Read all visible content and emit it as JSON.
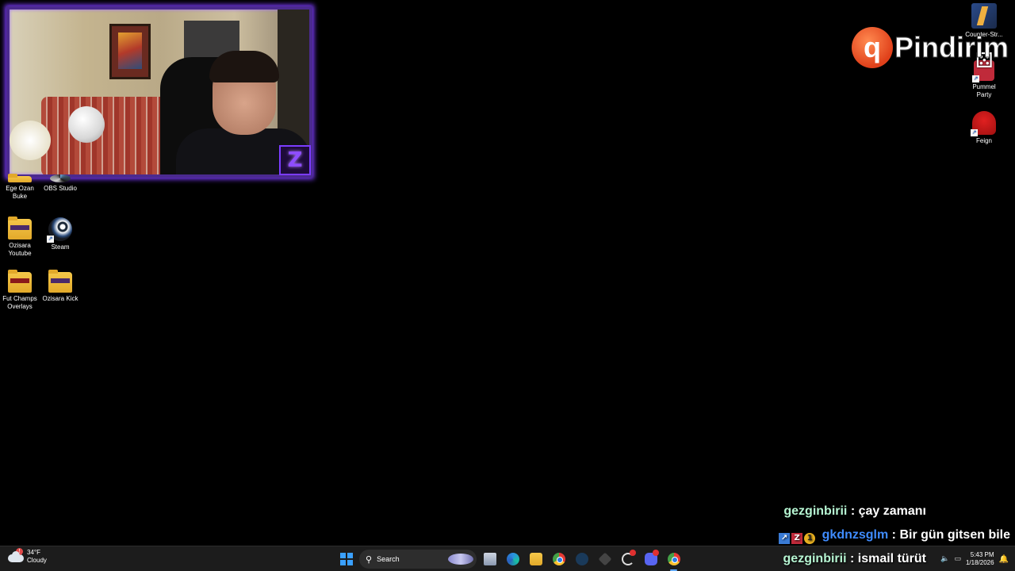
{
  "desktop": {
    "left_icons": [
      {
        "label": "Ege Ozan Buke",
        "icon": "folder-icon"
      },
      {
        "label": "OBS Studio",
        "icon": "obs-icon"
      },
      {
        "label": "Ozisara Youtube",
        "icon": "folder-icon"
      },
      {
        "label": "Steam",
        "icon": "steam-icon"
      },
      {
        "label": "Fut Champs Overlays",
        "icon": "folder-icon"
      },
      {
        "label": "Ozisara Kick",
        "icon": "folder-icon"
      }
    ],
    "right_icons": [
      {
        "label": "Counter-Str...",
        "icon": "counter-strike-icon"
      },
      {
        "label": "Pummel Party",
        "icon": "pummel-party-icon"
      },
      {
        "label": "Feign",
        "icon": "feign-icon"
      }
    ]
  },
  "overlay": {
    "logo_text": "Pindirim",
    "logo_mark": "q",
    "badge_glyph": "Z",
    "chat": [
      {
        "user": "gezginbirii",
        "separator": ":",
        "message": "çay zamanı",
        "user_color": "#b6f5d2"
      },
      {
        "user": "gkdnzsglm",
        "separator": ":",
        "message": "Bir gün gitsen bile",
        "user_color": "#3f8cff",
        "badges": [
          "↗",
          "Z",
          "1"
        ]
      },
      {
        "user": "gezginbirii",
        "separator": ":",
        "message": "ismail türüt",
        "user_color": "#b6f5d2"
      }
    ]
  },
  "taskbar": {
    "weather": {
      "temp": "34°F",
      "condition": "Cloudy",
      "alert_count": "!"
    },
    "search_placeholder": "Search",
    "tray": {
      "time": "5:43 PM",
      "date": "1/18/2026"
    }
  },
  "colors": {
    "webcam_border": "#7d3cff",
    "logo_orange": "#e0401a",
    "taskbar_bg": "#1c1c1c"
  }
}
